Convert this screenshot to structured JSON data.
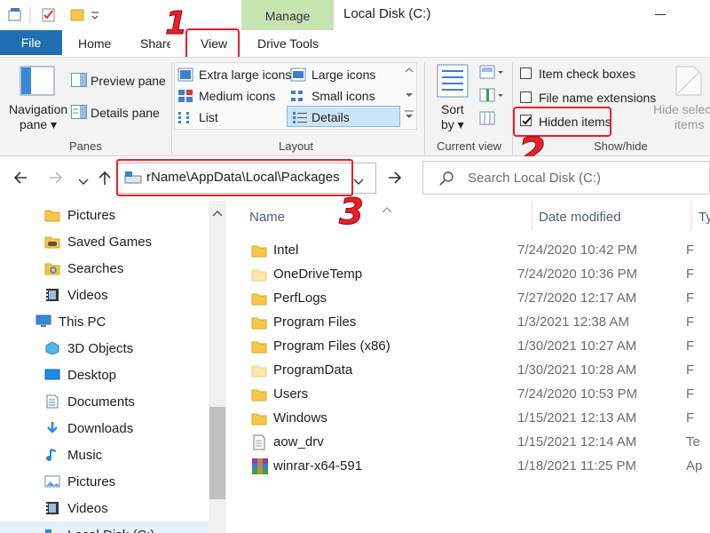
{
  "title_bar": {
    "manage_label": "Manage",
    "window_title": "Local Disk (C:)"
  },
  "tabs": {
    "file": "File",
    "home": "Home",
    "share": "Share",
    "view": "View",
    "drive_tools": "Drive Tools"
  },
  "ribbon": {
    "panes": {
      "navigation_pane_line1": "Navigation",
      "navigation_pane_line2": "pane",
      "preview_pane": "Preview pane",
      "details_pane": "Details pane",
      "group_label": "Panes"
    },
    "layout": {
      "extra_large_icons": "Extra large icons",
      "large_icons": "Large icons",
      "medium_icons": "Medium icons",
      "small_icons": "Small icons",
      "list": "List",
      "details": "Details",
      "group_label": "Layout"
    },
    "current_view": {
      "sort_line1": "Sort",
      "sort_line2": "by",
      "group_label": "Current view"
    },
    "show_hide": {
      "item_check_boxes": "Item check boxes",
      "file_name_extensions": "File name extensions",
      "hidden_items": "Hidden items",
      "hidden_items_checked": true,
      "hide_selected_line1": "Hide selected",
      "hide_selected_line2": "items",
      "group_label": "Show/hide"
    }
  },
  "address_bar": {
    "path": "rName\\AppData\\Local\\Packages"
  },
  "search": {
    "placeholder": "Search Local Disk (C:)"
  },
  "annotations": {
    "step1": "1",
    "step2": "2",
    "step3": "3"
  },
  "nav_pane": {
    "items": [
      {
        "label": "Pictures",
        "icon": "folder-icon",
        "indent": 1
      },
      {
        "label": "Saved Games",
        "icon": "saved-games-icon",
        "indent": 1
      },
      {
        "label": "Searches",
        "icon": "search-folder-icon",
        "indent": 1
      },
      {
        "label": "Videos",
        "icon": "videos-icon",
        "indent": 1
      },
      {
        "label": "This PC",
        "icon": "this-pc-icon",
        "indent": 0
      },
      {
        "label": "3D Objects",
        "icon": "3d-objects-icon",
        "indent": 1
      },
      {
        "label": "Desktop",
        "icon": "desktop-icon",
        "indent": 1
      },
      {
        "label": "Documents",
        "icon": "documents-icon",
        "indent": 1
      },
      {
        "label": "Downloads",
        "icon": "downloads-icon",
        "indent": 1
      },
      {
        "label": "Music",
        "icon": "music-icon",
        "indent": 1
      },
      {
        "label": "Pictures",
        "icon": "pictures-icon",
        "indent": 1
      },
      {
        "label": "Videos",
        "icon": "videos-icon",
        "indent": 1
      },
      {
        "label": "Local Disk (C:)",
        "icon": "drive-icon",
        "indent": 1
      }
    ]
  },
  "file_list": {
    "columns": {
      "name": "Name",
      "date_modified": "Date modified",
      "type": "Ty"
    },
    "rows": [
      {
        "name": "Intel",
        "date": "7/24/2020 10:42 PM",
        "type": "F",
        "icon": "folder-icon"
      },
      {
        "name": "OneDriveTemp",
        "date": "7/24/2020 10:36 PM",
        "type": "F",
        "icon": "faded-folder-icon"
      },
      {
        "name": "PerfLogs",
        "date": "7/27/2020 12:17 AM",
        "type": "F",
        "icon": "folder-icon"
      },
      {
        "name": "Program Files",
        "date": "1/3/2021 12:38 AM",
        "type": "F",
        "icon": "folder-icon"
      },
      {
        "name": "Program Files (x86)",
        "date": "1/30/2021 10:27 AM",
        "type": "F",
        "icon": "folder-icon"
      },
      {
        "name": "ProgramData",
        "date": "1/30/2021 10:28 AM",
        "type": "F",
        "icon": "faded-folder-icon"
      },
      {
        "name": "Users",
        "date": "7/24/2020 10:53 PM",
        "type": "F",
        "icon": "folder-icon"
      },
      {
        "name": "Windows",
        "date": "1/15/2021 12:13 AM",
        "type": "F",
        "icon": "folder-icon"
      },
      {
        "name": "aow_drv",
        "date": "1/15/2021 12:14 AM",
        "type": "Te",
        "icon": "text-file-icon"
      },
      {
        "name": "winrar-x64-591",
        "date": "1/18/2021 11:25 PM",
        "type": "Ap",
        "icon": "winrar-icon"
      }
    ]
  },
  "colors": {
    "accent": "#1f6fb2",
    "manage_tab": "#c7e5b2",
    "annotation_red": "#e8202a",
    "folder": "#f4c64a",
    "selected": "#cce4f7"
  }
}
